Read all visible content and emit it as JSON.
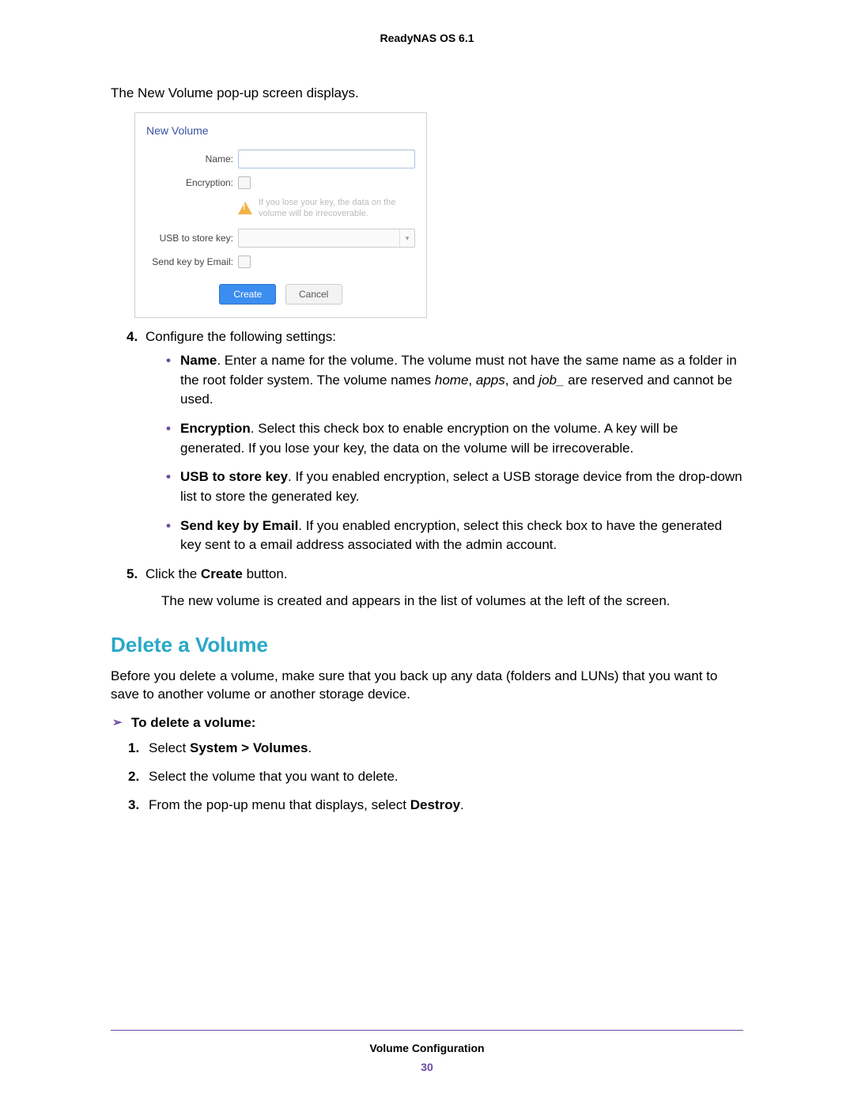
{
  "header": {
    "title": "ReadyNAS OS 6.1"
  },
  "intro": "The New Volume pop-up screen displays.",
  "popup": {
    "title": "New Volume",
    "labels": {
      "name": "Name:",
      "encryption": "Encryption:",
      "usb": "USB to store key:",
      "email": "Send key by Email:"
    },
    "warning": "If you lose your key, the data on the volume will be irrecoverable.",
    "buttons": {
      "create": "Create",
      "cancel": "Cancel"
    }
  },
  "steps_a": {
    "step4": {
      "num": "4.",
      "text": "Configure the following settings:",
      "bullets": {
        "name_label": "Name",
        "name_text": ". Enter a name for the volume. The volume must not have the same name as a folder in the root folder system. The volume names ",
        "name_i1": "home",
        "name_c1": ", ",
        "name_i2": "apps",
        "name_c2": ", and ",
        "name_i3": "job_",
        "name_tail": " are reserved and cannot be used.",
        "enc_label": "Encryption",
        "enc_text": ". Select this check box to enable encryption on the volume. A key will be generated. If you lose your key, the data on the volume will be irrecoverable.",
        "usb_label": "USB to store key",
        "usb_text": ". If you enabled encryption, select a USB storage device from the drop-down list to store the generated key.",
        "email_label": "Send key by Email",
        "email_text": ". If you enabled encryption, select this check box to have the generated key sent to a email address associated with the admin account."
      }
    },
    "step5": {
      "num": "5.",
      "pre": "Click the ",
      "b": "Create",
      "post": " button.",
      "after": "The new volume is created and appears in the list of volumes at the left of the screen."
    }
  },
  "section": {
    "title": "Delete a Volume",
    "intro": "Before you delete a volume, make sure that you back up any data (folders and LUNs) that you want to save to another volume or another storage device.",
    "proc": "To delete a volume:",
    "steps": {
      "s1": {
        "num": "1.",
        "pre": "Select ",
        "b": "System > Volumes",
        "post": "."
      },
      "s2": {
        "num": "2.",
        "text": "Select the volume that you want to delete."
      },
      "s3": {
        "num": "3.",
        "pre": "From the pop-up menu that displays, select ",
        "b": "Destroy",
        "post": "."
      }
    }
  },
  "footer": {
    "title": "Volume Configuration",
    "page": "30"
  }
}
